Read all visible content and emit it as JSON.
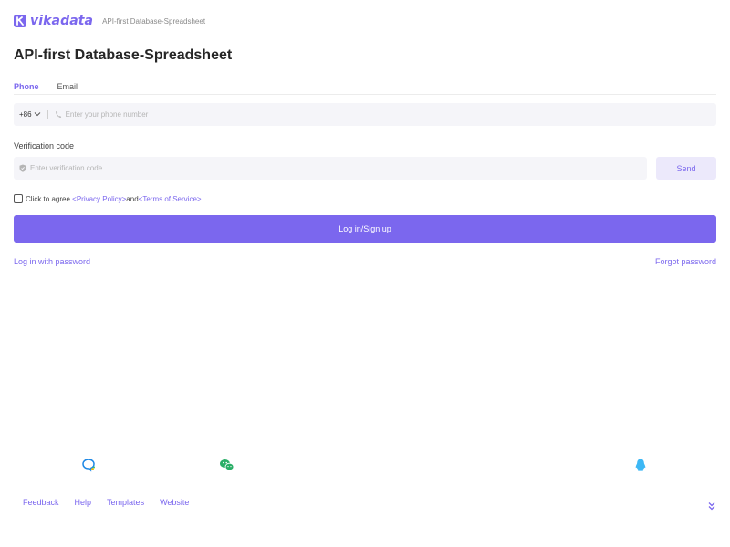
{
  "header": {
    "logo_text": "vikadata",
    "slogan": "API-first Database-Spreadsheet"
  },
  "main": {
    "title": "API-first Database-Spreadsheet",
    "tabs": [
      {
        "label": "Phone",
        "active": true
      },
      {
        "label": "Email",
        "active": false
      }
    ],
    "phone": {
      "area_code": "+86",
      "placeholder": "Enter your phone number",
      "value": ""
    },
    "verification": {
      "label": "Verification code",
      "placeholder": "Enter verification code",
      "value": "",
      "send_label": "Send"
    },
    "agreement": {
      "prefix": "Click to agree",
      "privacy": "<Privacy Policy>",
      "and": "and",
      "terms": "<Terms of Service>",
      "checked": false
    },
    "login_button": "Log in/Sign up",
    "password_login": "Log in with password",
    "forgot_password": "Forgot password"
  },
  "social": [
    {
      "icon": "chat-bubble-icon",
      "color": "#1e88e5"
    },
    {
      "icon": "wechat-icon",
      "color": "#2aae67"
    },
    {
      "icon": "qq-icon",
      "color": "#3db8f5"
    }
  ],
  "footer": {
    "links": [
      "Feedback",
      "Help",
      "Templates",
      "Website"
    ]
  },
  "colors": {
    "accent": "#7b67ee",
    "field_bg": "#f5f5f9",
    "send_bg": "#ece9fb"
  }
}
